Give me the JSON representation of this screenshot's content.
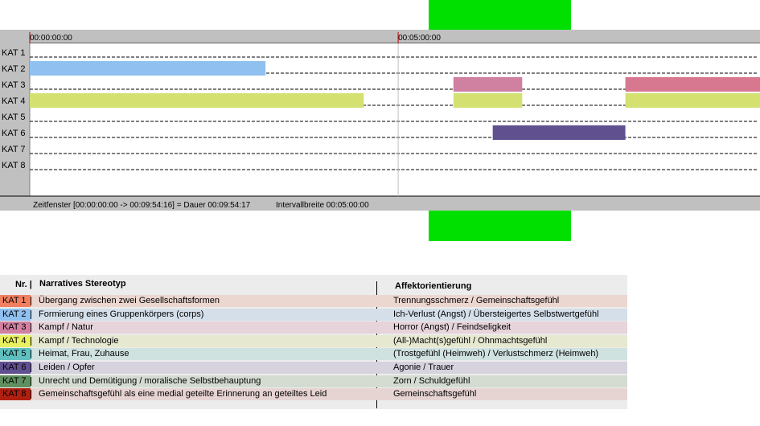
{
  "chart_data": {
    "type": "timeline",
    "x_range": [
      "00:00:00:00",
      "00:09:54:16"
    ],
    "ticks": [
      "00:00:00:00",
      "00:05:00:00"
    ],
    "rows": [
      "KAT 1",
      "KAT 2",
      "KAT 3",
      "KAT 4",
      "KAT 5",
      "KAT 6",
      "KAT 7",
      "KAT 8"
    ],
    "segments": [
      {
        "row": "KAT 2",
        "start": "00:00:00:00",
        "end": "00:03:12:00",
        "color": "#90c0f0"
      },
      {
        "row": "KAT 3",
        "start": "00:05:45:00",
        "end": "00:06:41:00",
        "color": "#d080a0"
      },
      {
        "row": "KAT 3",
        "start": "00:08:05:00",
        "end": "00:09:54:16",
        "color": "#d87890"
      },
      {
        "row": "KAT 4",
        "start": "00:00:00:00",
        "end": "00:04:32:00",
        "color": "#d4e070"
      },
      {
        "row": "KAT 4",
        "start": "00:05:45:00",
        "end": "00:06:41:00",
        "color": "#d4e070"
      },
      {
        "row": "KAT 4",
        "start": "00:08:05:00",
        "end": "00:09:54:16",
        "color": "#d4e070"
      },
      {
        "row": "KAT 6",
        "start": "00:06:17:00",
        "end": "00:08:05:00",
        "color": "#605090"
      }
    ],
    "highlight_window": {
      "start": "00:06:17:00",
      "end": "00:08:05:00",
      "color": "#00e000"
    },
    "footer": {
      "window": "Zeitfenster [00:00:00:00 -> 00:09:54:16] = Dauer 00:09:54:17",
      "interval": "Intervallbreite 00:05:00:00"
    }
  },
  "legend": {
    "header_nr": "Nr. |",
    "header_stereotype": "Narratives Stereotyp",
    "header_affect": "Affektorientierung",
    "rows": [
      {
        "kat": "KAT 1",
        "color": "#f08060",
        "bg": "#ecd6d0",
        "stereotype": "Übergang zwischen zwei Gesellschaftsformen",
        "affect": "Trennungsschmerz / Gemeinschaftsgefühl"
      },
      {
        "kat": "KAT 2",
        "color": "#90c0f0",
        "bg": "#d4dfea",
        "stereotype": "Formierung eines Gruppenkörpers (corps)",
        "affect": "Ich-Verlust (Angst) / Übersteigertes Selbstwertgefühl"
      },
      {
        "kat": "KAT 3",
        "color": "#d080a0",
        "bg": "#e6d4da",
        "stereotype": "Kampf / Natur",
        "affect": "Horror (Angst) / Feindseligkeit"
      },
      {
        "kat": "KAT 4",
        "color": "#e8f060",
        "bg": "#e6e8d0",
        "stereotype": "Kampf / Technologie",
        "affect": "(All-)Macht(s)gefühl / Ohnmachtsgefühl"
      },
      {
        "kat": "KAT 5",
        "color": "#60c0c0",
        "bg": "#d0e2e0",
        "stereotype": "Heimat, Frau, Zuhause",
        "affect": "(Trostgefühl (Heimweh) / Verlustschmerz (Heimweh)"
      },
      {
        "kat": "KAT 6",
        "color": "#605090",
        "bg": "#d6d2de",
        "stereotype": "Leiden / Opfer",
        "affect": "Agonie / Trauer"
      },
      {
        "kat": "KAT 7",
        "color": "#609060",
        "bg": "#d4dcd2",
        "stereotype": "Unrecht und Demütigung / moralische Selbstbehauptung",
        "affect": "Zorn / Schuldgefühl"
      },
      {
        "kat": "KAT 8",
        "color": "#b02010",
        "bg": "#e6d4d2",
        "stereotype": "Gemeinschaftsgefühl als eine medial geteilte Erinnerung an geteiltes Leid",
        "affect": "Gemeinschaftsgefühl"
      }
    ]
  }
}
